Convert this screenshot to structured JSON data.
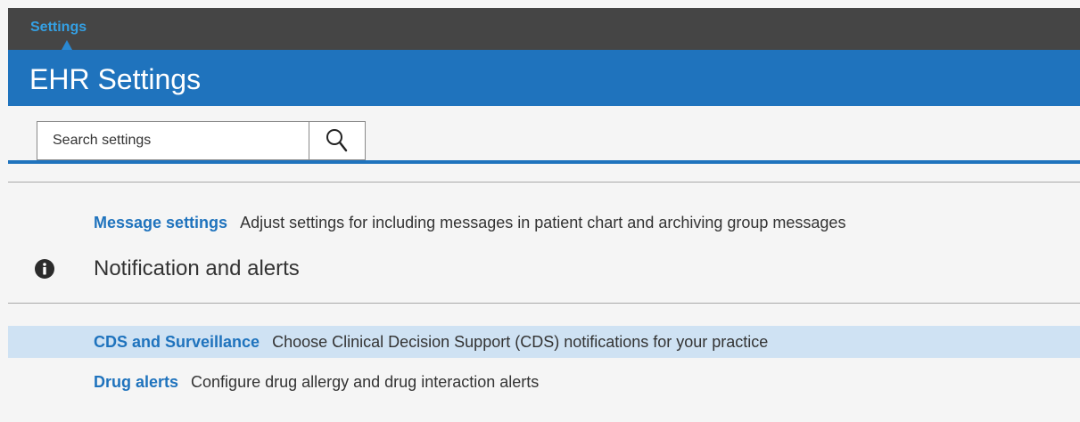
{
  "topbar": {
    "breadcrumb": "Settings"
  },
  "header": {
    "title": "EHR Settings"
  },
  "search": {
    "placeholder": "Search settings",
    "value": "",
    "icon": "search-icon"
  },
  "messages_section": {
    "items": [
      {
        "label": "Message settings",
        "description": "Adjust settings for including messages in patient chart and archiving group messages"
      }
    ]
  },
  "notifications_section": {
    "title": "Notification and alerts",
    "icon": "info-icon",
    "items": [
      {
        "label": "CDS and Surveillance",
        "description": "Choose Clinical Decision Support (CDS) notifications for your practice",
        "highlighted": true
      },
      {
        "label": "Drug alerts",
        "description": "Configure drug allergy and drug interaction alerts",
        "highlighted": false
      }
    ]
  },
  "colors": {
    "topbar": "#454545",
    "titlebar": "#1f73bd",
    "link": "#1f73bd",
    "breadcrumb": "#34a0e4",
    "highlight_row": "#cfe2f3"
  }
}
